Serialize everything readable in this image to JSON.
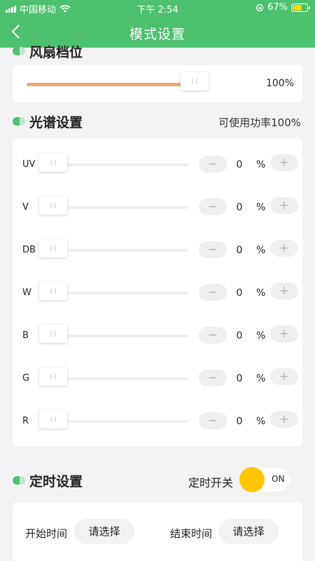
{
  "status_bar": {
    "carrier": "中国移动",
    "time": "下午 2:54",
    "battery": "67%",
    "battery_level": 0.67
  },
  "nav": {
    "title": "模式设置"
  },
  "fan": {
    "title": "风扇档位",
    "value_text": "100%",
    "level": 1.0
  },
  "spectrum": {
    "title": "光谱设置",
    "power_text": "可使用功率100%",
    "percent_symbol": "%",
    "minus": "−",
    "plus": "+",
    "channels": [
      {
        "label": "UV",
        "value": "0"
      },
      {
        "label": "V",
        "value": "0"
      },
      {
        "label": "DB",
        "value": "0"
      },
      {
        "label": "W",
        "value": "0"
      },
      {
        "label": "B",
        "value": "0"
      },
      {
        "label": "G",
        "value": "0"
      },
      {
        "label": "R",
        "value": "0"
      }
    ]
  },
  "timer": {
    "title": "定时设置",
    "switch_label": "定时开关",
    "switch_state": "ON",
    "start_label": "开始时间",
    "start_value": "请选择",
    "end_label": "结束时间",
    "end_value": "请选择"
  },
  "colors": {
    "primary": "#4dc16e",
    "fan_track": "#f4a580",
    "toggle_knob": "#ffc400",
    "battery_fill": "#ffd60a"
  }
}
